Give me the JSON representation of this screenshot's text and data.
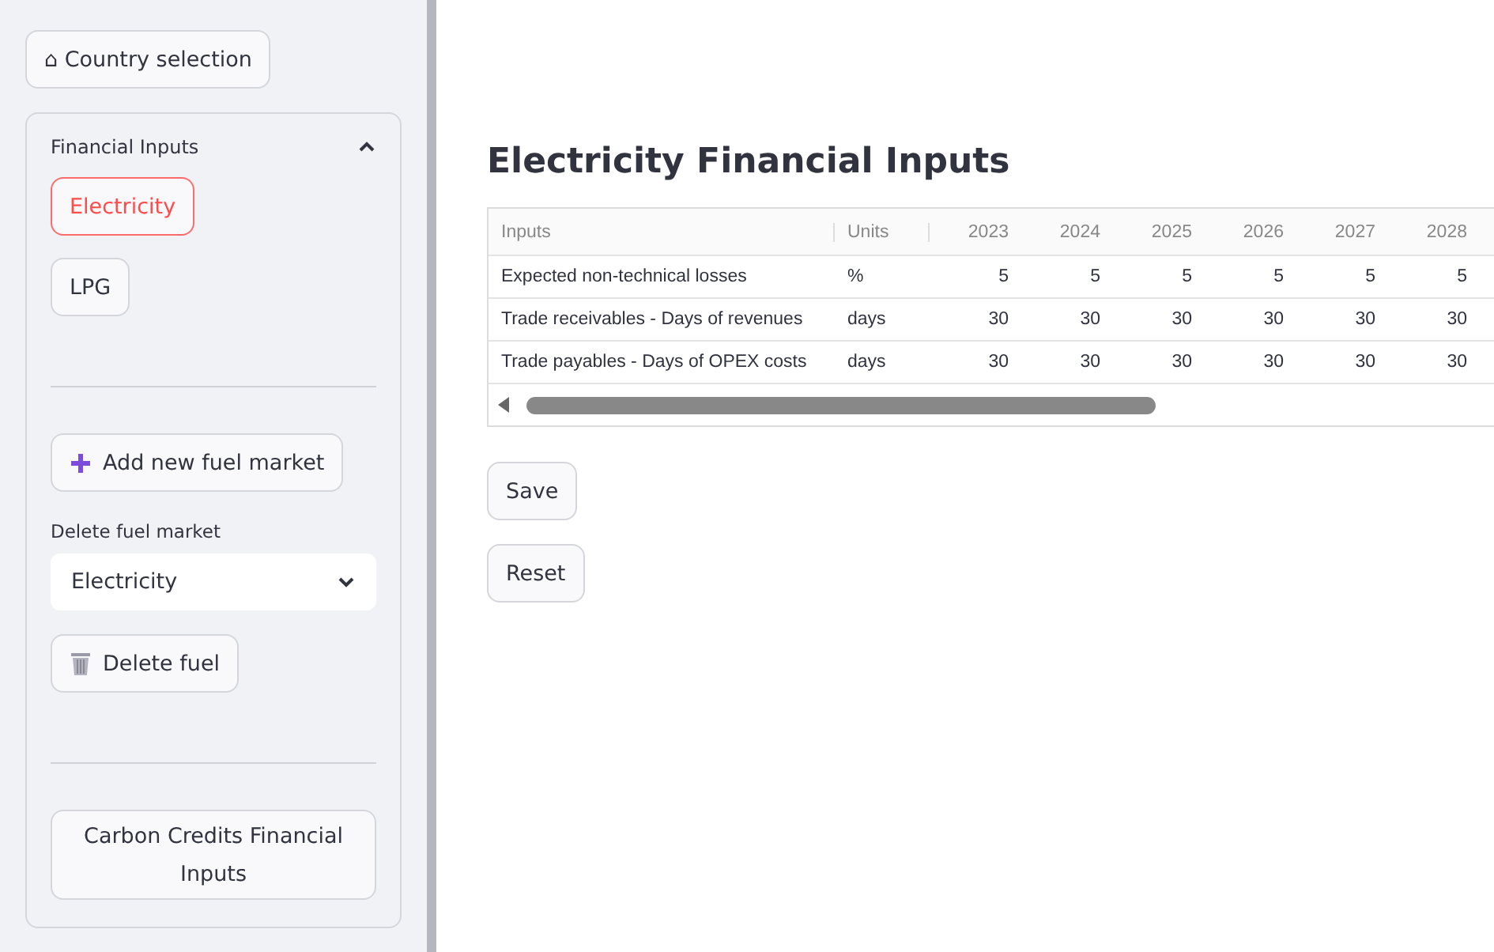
{
  "sidebar": {
    "home_button": {
      "icon": "⌂",
      "label": "Country selection"
    },
    "expander": {
      "title": "Financial Inputs",
      "expanded": true,
      "fuel_buttons": [
        {
          "label": "Electricity",
          "selected": true
        },
        {
          "label": "LPG",
          "selected": false
        }
      ],
      "add_button": "Add new fuel market",
      "delete_select": {
        "label": "Delete fuel market",
        "value": "Electricity"
      },
      "delete_button": "Delete fuel",
      "carbon_button": "Carbon Credits Financial Inputs"
    }
  },
  "main": {
    "title": "Electricity Financial Inputs",
    "table": {
      "columns": [
        "Inputs",
        "Units",
        "2023",
        "2024",
        "2025",
        "2026",
        "2027",
        "2028"
      ],
      "rows": [
        [
          "Expected non-technical losses",
          "%",
          "5",
          "5",
          "5",
          "5",
          "5",
          "5"
        ],
        [
          "Trade receivables - Days of revenues",
          "days",
          "30",
          "30",
          "30",
          "30",
          "30",
          "30"
        ],
        [
          "Trade payables - Days of OPEX costs",
          "days",
          "30",
          "30",
          "30",
          "30",
          "30",
          "30"
        ]
      ]
    },
    "buttons": [
      "Save",
      "Reset"
    ]
  }
}
